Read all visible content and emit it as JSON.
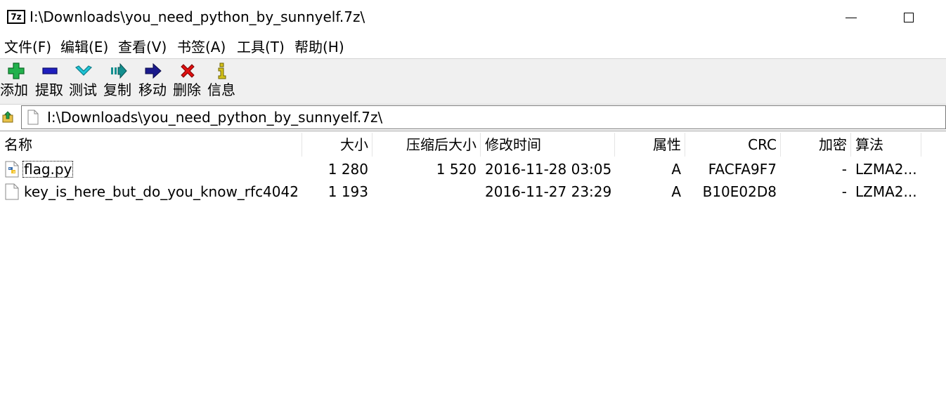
{
  "window": {
    "title": "I:\\Downloads\\you_need_python_by_sunnyelf.7z\\",
    "app_icon_text": "7z"
  },
  "menu": [
    {
      "label": "文件(F)"
    },
    {
      "label": "编辑(E)"
    },
    {
      "label": "查看(V)"
    },
    {
      "label": "书签(A)"
    },
    {
      "label": "工具(T)"
    },
    {
      "label": "帮助(H)"
    }
  ],
  "toolbar": {
    "add_label": "添加",
    "extract_label": "提取",
    "test_label": "测试",
    "copy_label": "复制",
    "move_label": "移动",
    "delete_label": "删除",
    "info_label": "信息",
    "colors": {
      "add": "#22b14c",
      "extract": "#1f1fbf",
      "test": "#1fc4d6",
      "copy": "#138f8f",
      "move": "#1a1a8c",
      "delete": "#e01010",
      "info": "#d4c21a"
    }
  },
  "address": {
    "path": "I:\\Downloads\\you_need_python_by_sunnyelf.7z\\"
  },
  "columns": {
    "name": "名称",
    "size": "大小",
    "packed": "压缩后大小",
    "modified": "修改时间",
    "attributes": "属性",
    "crc": "CRC",
    "encrypted": "加密",
    "method": "算法"
  },
  "files": [
    {
      "name": "flag.py",
      "icon": "python-file-icon",
      "size": "1 280",
      "packed": "1 520",
      "modified": "2016-11-28 03:05",
      "attributes": "A",
      "crc": "FACFA9F7",
      "encrypted": "-",
      "method": "LZMA2..."
    },
    {
      "name": "key_is_here_but_do_you_know_rfc4042",
      "icon": "blank-file-icon",
      "size": "1 193",
      "packed": "",
      "modified": "2016-11-27 23:29",
      "attributes": "A",
      "crc": "B10E02D8",
      "encrypted": "-",
      "method": "LZMA2..."
    }
  ]
}
